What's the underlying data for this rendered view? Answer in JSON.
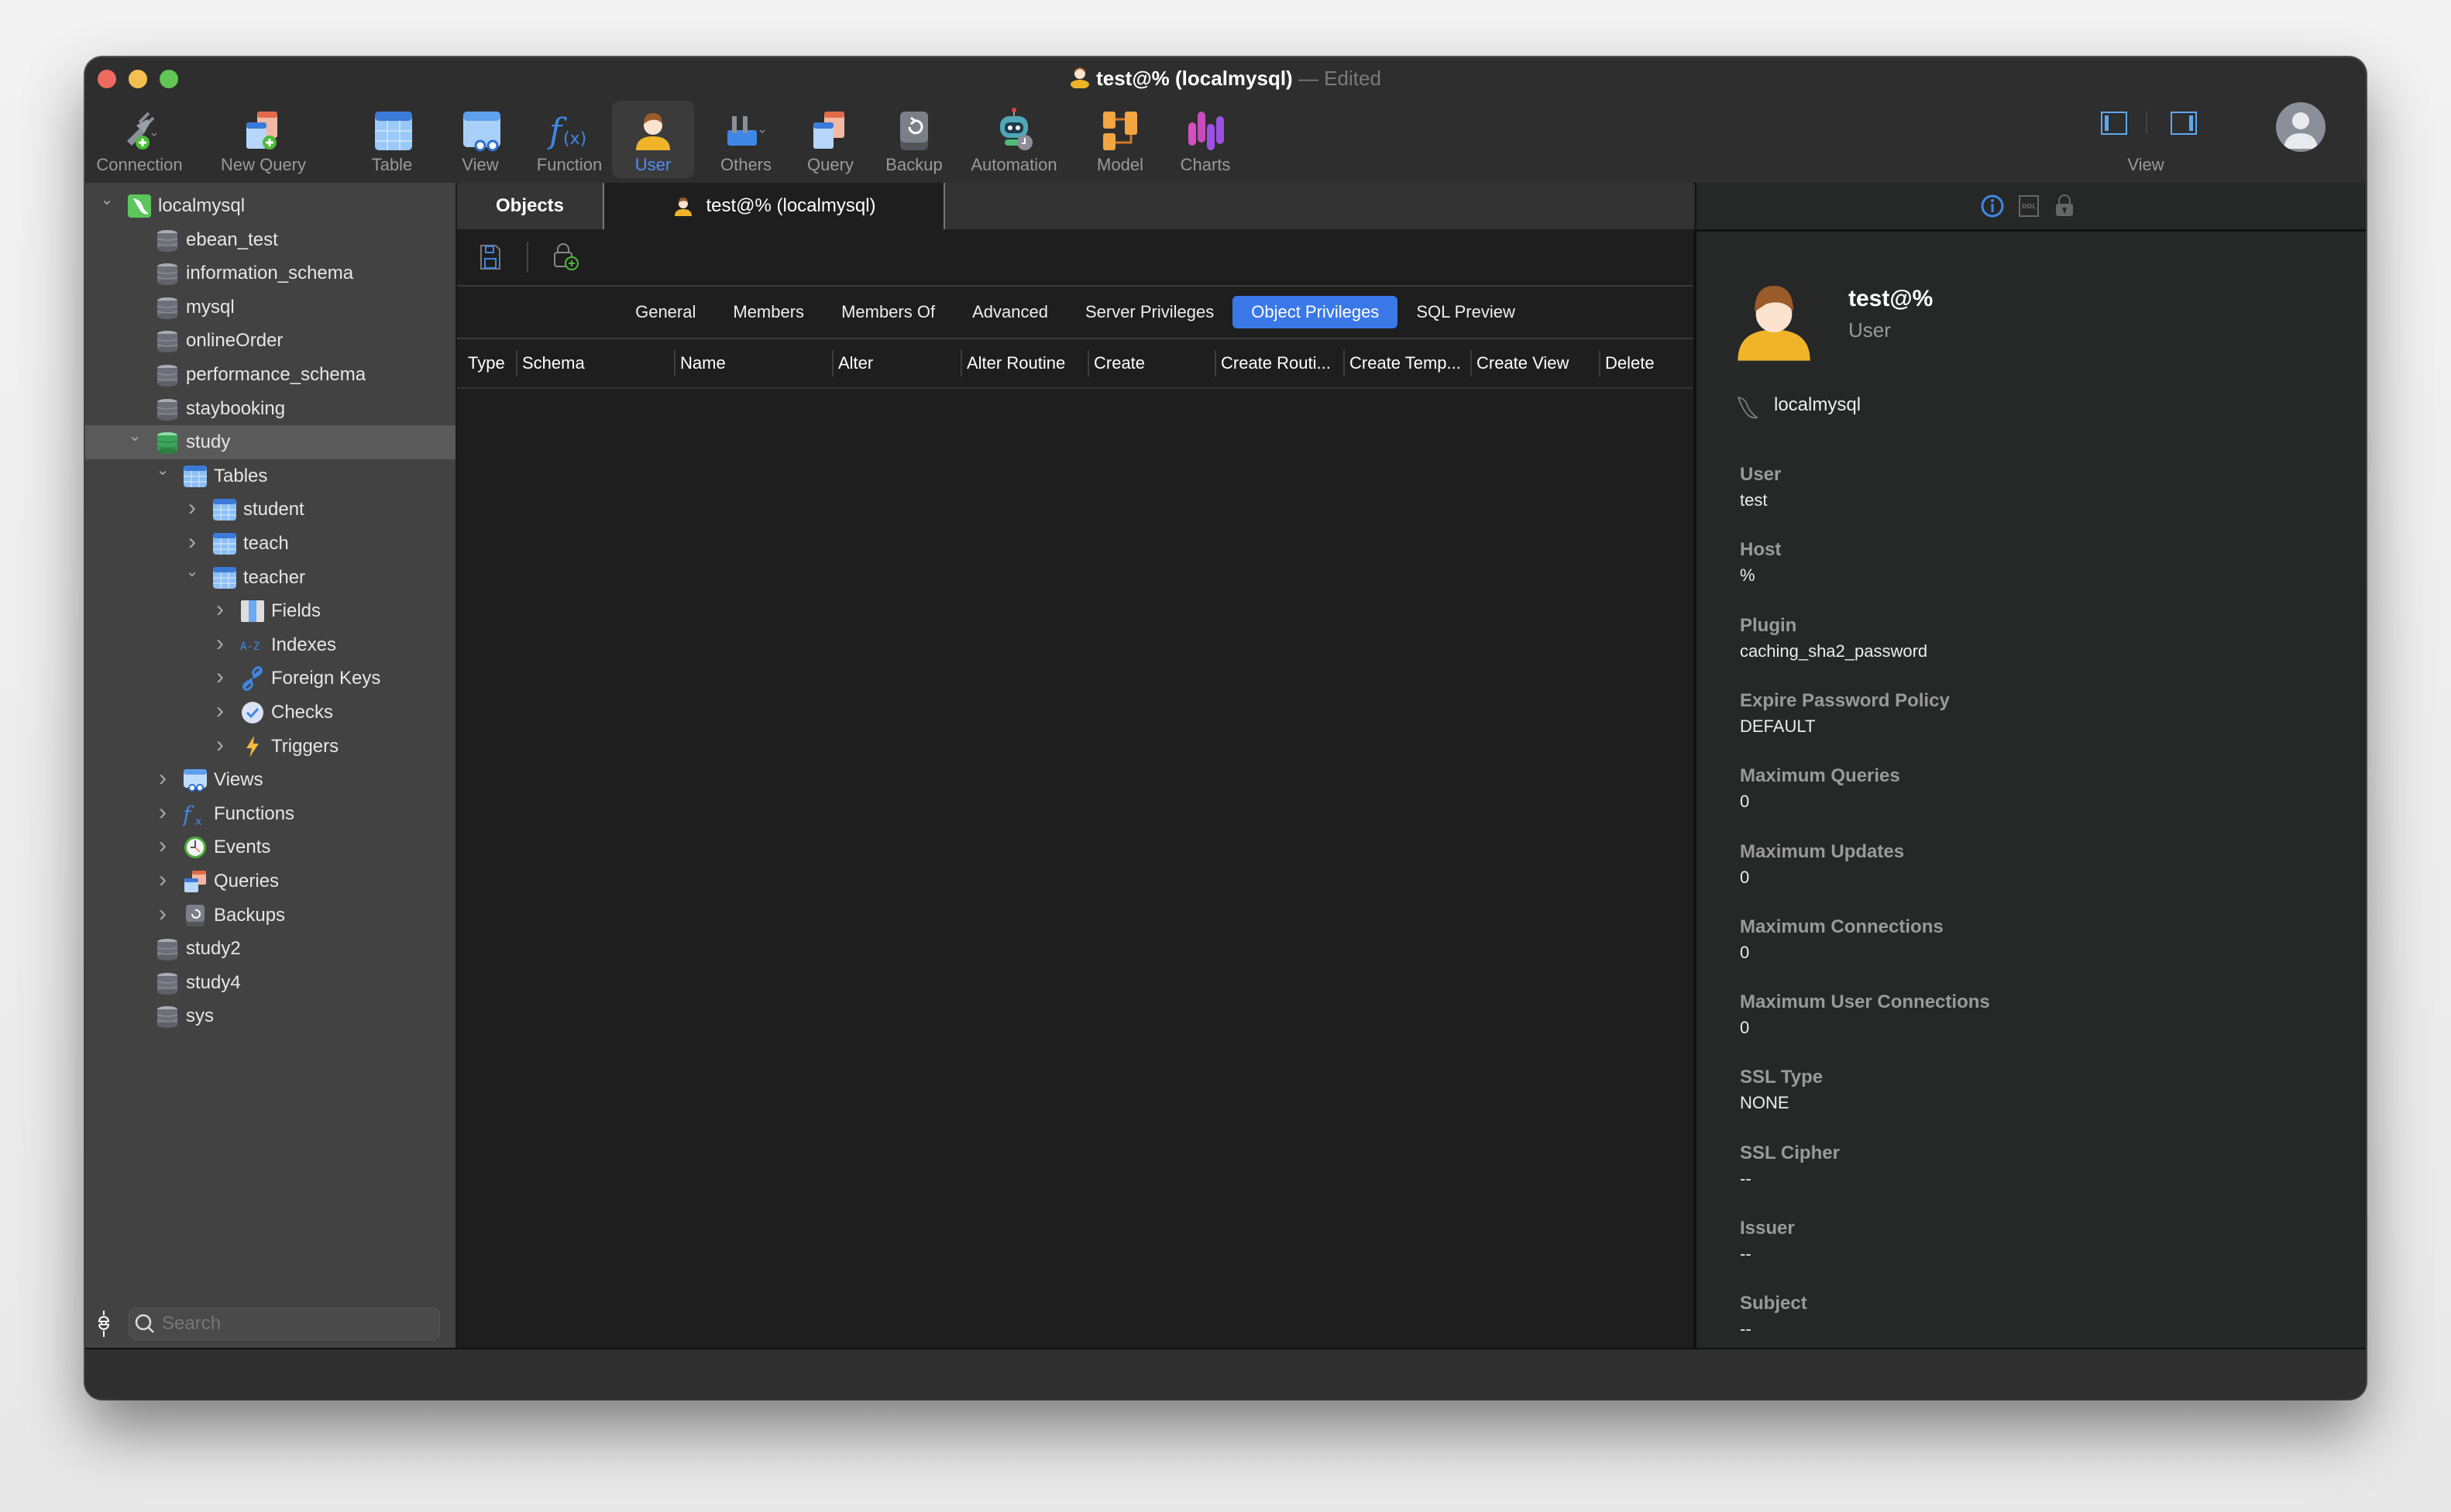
{
  "window": {
    "title": "test@% (localmysql)",
    "title_suffix": "— Edited"
  },
  "toolbar": {
    "buttons": [
      {
        "id": "connection",
        "label": "Connection",
        "icon": "plug-add-icon"
      },
      {
        "id": "new-query",
        "label": "New Query",
        "icon": "new-query-icon"
      },
      {
        "id": "table",
        "label": "Table",
        "icon": "table-icon"
      },
      {
        "id": "view",
        "label": "View",
        "icon": "view-icon"
      },
      {
        "id": "function",
        "label": "Function",
        "icon": "function-icon"
      },
      {
        "id": "user",
        "label": "User",
        "icon": "user-icon",
        "active": true
      },
      {
        "id": "others",
        "label": "Others",
        "icon": "tools-icon"
      },
      {
        "id": "query",
        "label": "Query",
        "icon": "query-icon"
      },
      {
        "id": "backup",
        "label": "Backup",
        "icon": "backup-icon"
      },
      {
        "id": "automation",
        "label": "Automation",
        "icon": "robot-icon"
      },
      {
        "id": "model",
        "label": "Model",
        "icon": "model-icon"
      },
      {
        "id": "charts",
        "label": "Charts",
        "icon": "charts-icon"
      }
    ],
    "view_label": "View",
    "accent": "#4d8ff7"
  },
  "sidebar": {
    "tree": [
      {
        "label": "localmysql",
        "icon": "mysql-connection-icon",
        "level": 0,
        "chevron": "down"
      },
      {
        "label": "ebean_test",
        "icon": "database-icon",
        "level": 1
      },
      {
        "label": "information_schema",
        "icon": "database-icon",
        "level": 1
      },
      {
        "label": "mysql",
        "icon": "database-icon",
        "level": 1
      },
      {
        "label": "onlineOrder",
        "icon": "database-icon",
        "level": 1
      },
      {
        "label": "performance_schema",
        "icon": "database-icon",
        "level": 1
      },
      {
        "label": "staybooking",
        "icon": "database-icon",
        "level": 1
      },
      {
        "label": "study",
        "icon": "database-open-icon",
        "level": 1,
        "chevron": "down",
        "selected": true
      },
      {
        "label": "Tables",
        "icon": "tables-icon",
        "level": 2,
        "chevron": "down"
      },
      {
        "label": "student",
        "icon": "table-icon",
        "level": 3,
        "chevron": "right"
      },
      {
        "label": "teach",
        "icon": "table-icon",
        "level": 3,
        "chevron": "right"
      },
      {
        "label": "teacher",
        "icon": "table-icon",
        "level": 3,
        "chevron": "down"
      },
      {
        "label": "Fields",
        "icon": "fields-icon",
        "level": 4,
        "chevron": "right"
      },
      {
        "label": "Indexes",
        "icon": "indexes-icon",
        "level": 4,
        "chevron": "right"
      },
      {
        "label": "Foreign Keys",
        "icon": "link-icon",
        "level": 4,
        "chevron": "right"
      },
      {
        "label": "Checks",
        "icon": "check-icon",
        "level": 4,
        "chevron": "right"
      },
      {
        "label": "Triggers",
        "icon": "lightning-icon",
        "level": 4,
        "chevron": "right"
      },
      {
        "label": "Views",
        "icon": "view-icon",
        "level": 2,
        "chevron": "right"
      },
      {
        "label": "Functions",
        "icon": "function-icon",
        "level": 2,
        "chevron": "right"
      },
      {
        "label": "Events",
        "icon": "clock-icon",
        "level": 2,
        "chevron": "right"
      },
      {
        "label": "Queries",
        "icon": "query-icon",
        "level": 2,
        "chevron": "right"
      },
      {
        "label": "Backups",
        "icon": "backup-icon",
        "level": 2,
        "chevron": "right"
      },
      {
        "label": "study2",
        "icon": "database-icon",
        "level": 1
      },
      {
        "label": "study4",
        "icon": "database-icon",
        "level": 1
      },
      {
        "label": "sys",
        "icon": "database-icon",
        "level": 1
      }
    ],
    "search_placeholder": "Search",
    "search_value": ""
  },
  "tabs": [
    {
      "label": "Objects"
    },
    {
      "label": "test@% (localmysql)",
      "icon": "user-icon",
      "active": true
    }
  ],
  "editor": {
    "subtabs": [
      "General",
      "Members",
      "Members Of",
      "Advanced",
      "Server Privileges",
      "Object Privileges",
      "SQL Preview"
    ],
    "active_subtab": "Object Privileges",
    "columns": [
      "Type",
      "Schema",
      "Name",
      "Alter",
      "Alter Routine",
      "Create",
      "Create Routi...",
      "Create Temp...",
      "Create View",
      "Delete"
    ],
    "rows": []
  },
  "info_panel": {
    "name": "test@%",
    "type": "User",
    "connection": "localmysql",
    "properties": [
      {
        "label": "User",
        "value": "test"
      },
      {
        "label": "Host",
        "value": "%"
      },
      {
        "label": "Plugin",
        "value": "caching_sha2_password"
      },
      {
        "label": "Expire Password Policy",
        "value": "DEFAULT"
      },
      {
        "label": "Maximum Queries",
        "value": "0"
      },
      {
        "label": "Maximum Updates",
        "value": "0"
      },
      {
        "label": "Maximum Connections",
        "value": "0"
      },
      {
        "label": "Maximum User Connections",
        "value": "0"
      },
      {
        "label": "SSL Type",
        "value": "NONE"
      },
      {
        "label": "SSL Cipher",
        "value": "--"
      },
      {
        "label": "Issuer",
        "value": "--"
      },
      {
        "label": "Subject",
        "value": "--"
      }
    ]
  }
}
